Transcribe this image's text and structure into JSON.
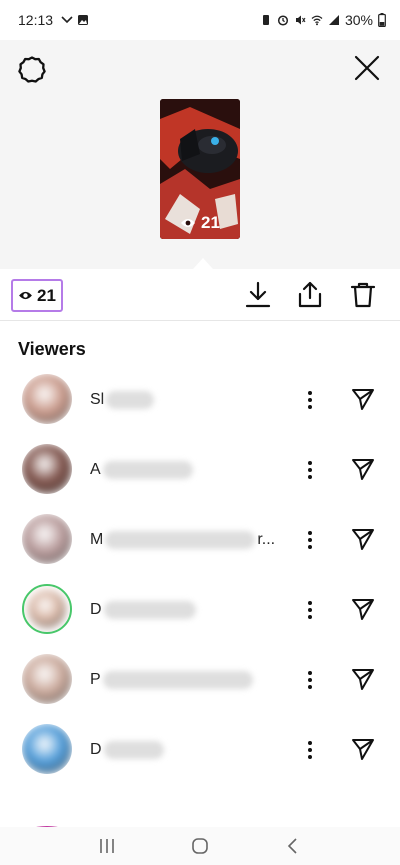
{
  "status_bar": {
    "time": "12:13",
    "battery": "30%"
  },
  "story": {
    "views": "21"
  },
  "header": {
    "view_count": "21"
  },
  "viewers_title": "Viewers",
  "viewers": [
    {
      "initial": "Sl",
      "trail": "",
      "avatar_color": "#c9998a",
      "ring": false
    },
    {
      "initial": "A",
      "trail": "",
      "avatar_color": "#7d5048",
      "ring": false
    },
    {
      "initial": "M",
      "trail": "r...",
      "avatar_color": "#b89a9a",
      "ring": false
    },
    {
      "initial": "D",
      "trail": "",
      "avatar_color": "#d9b7a6",
      "ring": true
    },
    {
      "initial": "P",
      "trail": "",
      "avatar_color": "#caa89a",
      "ring": false
    },
    {
      "initial": "D",
      "trail": "",
      "avatar_color": "#4d9ad8",
      "ring": false
    }
  ],
  "colors": {
    "highlight": "#b57be8",
    "close_friend_ring": "#48c76a",
    "story_ring": "#c13aa0"
  }
}
